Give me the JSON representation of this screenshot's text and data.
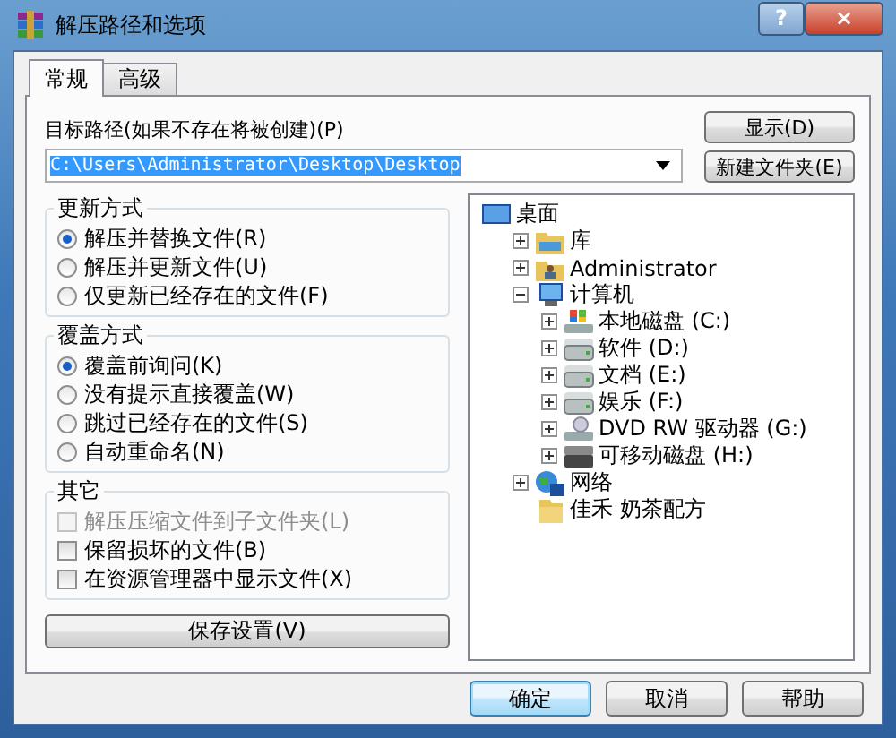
{
  "window": {
    "title": "解压路径和选项",
    "help_button": "?",
    "close_button": "×"
  },
  "tabs": [
    {
      "label": "常规",
      "selected": true
    },
    {
      "label": "高级",
      "selected": false
    }
  ],
  "path": {
    "label": "目标路径(如果不存在将被创建)(P)",
    "value": "C:\\Users\\Administrator\\Desktop\\Desktop",
    "selected": true
  },
  "side_buttons": [
    "显示(D)",
    "新建文件夹(E)"
  ],
  "groups": [
    {
      "title": "更新方式",
      "kind": "radio",
      "options": [
        {
          "label": "解压并替换文件(R)",
          "selected": true,
          "disabled": false
        },
        {
          "label": "解压并更新文件(U)",
          "selected": false,
          "disabled": false
        },
        {
          "label": "仅更新已经存在的文件(F)",
          "selected": false,
          "disabled": false
        }
      ]
    },
    {
      "title": "覆盖方式",
      "kind": "radio",
      "options": [
        {
          "label": "覆盖前询问(K)",
          "selected": true,
          "disabled": false
        },
        {
          "label": "没有提示直接覆盖(W)",
          "selected": false,
          "disabled": false
        },
        {
          "label": "跳过已经存在的文件(S)",
          "selected": false,
          "disabled": false
        },
        {
          "label": "自动重命名(N)",
          "selected": false,
          "disabled": false
        }
      ]
    },
    {
      "title": "其它",
      "kind": "checkbox",
      "options": [
        {
          "label": "解压压缩文件到子文件夹(L)",
          "checked": false,
          "disabled": true
        },
        {
          "label": "保留损坏的文件(B)",
          "checked": false,
          "disabled": false
        },
        {
          "label": "在资源管理器中显示文件(X)",
          "checked": false,
          "disabled": false
        }
      ]
    }
  ],
  "save_button": "保存设置(V)",
  "tree": [
    {
      "label": "桌面",
      "kind": "desktop",
      "children": [
        {
          "label": "库",
          "kind": "library",
          "expanded": false
        },
        {
          "label": "Administrator",
          "kind": "user",
          "expanded": false
        },
        {
          "label": "计算机",
          "kind": "computer",
          "expanded": true,
          "children": [
            {
              "label": "本地磁盘 (C:)",
              "kind": "system-drive",
              "expanded": false
            },
            {
              "label": "软件 (D:)",
              "kind": "drive",
              "expanded": false
            },
            {
              "label": "文档 (E:)",
              "kind": "drive",
              "expanded": false
            },
            {
              "label": "娱乐 (F:)",
              "kind": "drive",
              "expanded": false
            },
            {
              "label": "DVD RW 驱动器 (G:)",
              "kind": "dvd",
              "expanded": false
            },
            {
              "label": "可移动磁盘 (H:)",
              "kind": "removable",
              "expanded": false
            }
          ]
        },
        {
          "label": "网络",
          "kind": "network",
          "expanded": false
        },
        {
          "label": "佳禾 奶茶配方",
          "kind": "folder"
        }
      ]
    }
  ],
  "buttons": [
    {
      "label": "确定",
      "kind": "default"
    },
    {
      "label": "取消",
      "kind": "normal"
    },
    {
      "label": "帮助",
      "kind": "normal"
    }
  ]
}
